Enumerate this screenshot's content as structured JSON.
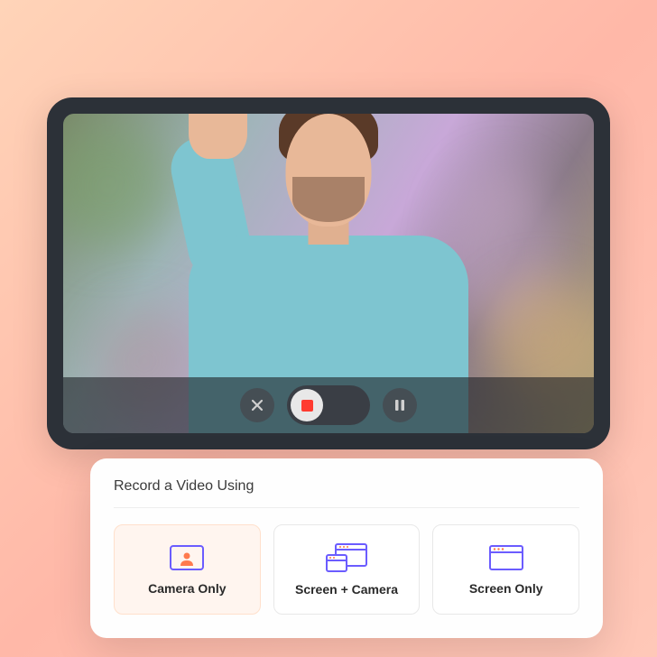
{
  "controls": {
    "close": "close",
    "record": "record",
    "pause": "pause"
  },
  "panel": {
    "title": "Record a Video Using",
    "options": [
      {
        "label": "Camera Only",
        "active": true
      },
      {
        "label": "Screen + Camera",
        "active": false
      },
      {
        "label": "Screen Only",
        "active": false
      }
    ]
  }
}
